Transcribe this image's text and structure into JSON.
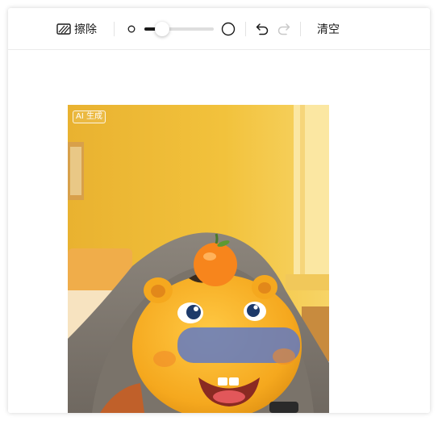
{
  "toolbar": {
    "erase_label": "擦除",
    "clear_label": "清空",
    "brush_size_fraction": 0.25,
    "redo_enabled": false,
    "icons": [
      "eraser-icon",
      "brush-small-icon",
      "brush-large-icon",
      "undo-icon",
      "redo-icon"
    ]
  },
  "canvas": {
    "badge": "AI 生成"
  },
  "colors": {
    "accent": "#1a1a1a",
    "disabled": "#c8c8c8",
    "mask": "#5b78c8",
    "background": "#f4c63a"
  }
}
